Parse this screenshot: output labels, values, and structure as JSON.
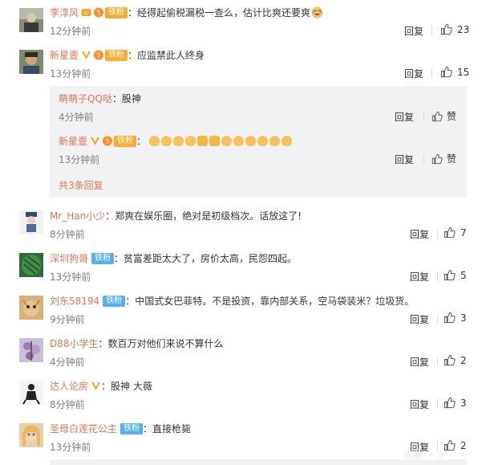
{
  "colors": {
    "username": "#eb7350",
    "fan_orange": "#ffab2e",
    "fan_blue": "#53b1ee",
    "subbox_bg": "#f2f2f5",
    "time_gray": "#808080"
  },
  "labels": {
    "reply": "回复",
    "like_text": "赞",
    "more_replies": "共3条回复"
  },
  "comments": [
    {
      "user": "李淳风",
      "badge": "铁粉",
      "text": "经得起偷税漏税一查么，估计比爽还要爽",
      "time": "12分钟前",
      "likes": "23",
      "icons": [
        "vip-icon",
        "level-icon"
      ]
    },
    {
      "user": "新星壹",
      "badge": "铁粉",
      "text": "应监禁此人终身",
      "time": "13分钟前",
      "likes": "15",
      "icons": [
        "verified-v-icon",
        "level-icon"
      ]
    },
    {
      "user": "Mr_Han小少",
      "badge": "",
      "text": "郑爽在娱乐圈，绝对是初级档次。话放这了!",
      "time": "8分钟前",
      "likes": "7"
    },
    {
      "user": "深圳狗哥",
      "badge": "铁粉",
      "text": "贫富差距太大了，房价太高，民怨四起。",
      "time": "13分钟前",
      "likes": "5"
    },
    {
      "user": "刘东58194",
      "badge": "铁粉",
      "text": "中国式女巴菲特。不是投资，靠内部关系，空马袋装米？垃圾货。",
      "time": "9分钟前",
      "likes": "3"
    },
    {
      "user": "D88小学生",
      "badge": "",
      "text": "数百万对他们来说不算什么",
      "time": "4分钟前",
      "likes": "2"
    },
    {
      "user": "达人论房",
      "badge": "",
      "text": "股神 大薇",
      "time": "8分钟前",
      "likes": "3",
      "icons": [
        "verified-v-icon"
      ]
    },
    {
      "user": "圣母白莲花公主",
      "badge": "铁粉",
      "text": "直接枪毙",
      "time": "13分钟前",
      "likes": "2"
    }
  ],
  "sub_replies": [
    {
      "user": "萌萌子QQ哒",
      "text": "股神",
      "time": "4分钟前"
    },
    {
      "user": "新星壹",
      "badge": "铁粉",
      "text": "",
      "time": "13分钟前",
      "icons": [
        "verified-v-icon",
        "level-icon"
      ]
    }
  ],
  "watermark": "白鹿 ∞ 少"
}
